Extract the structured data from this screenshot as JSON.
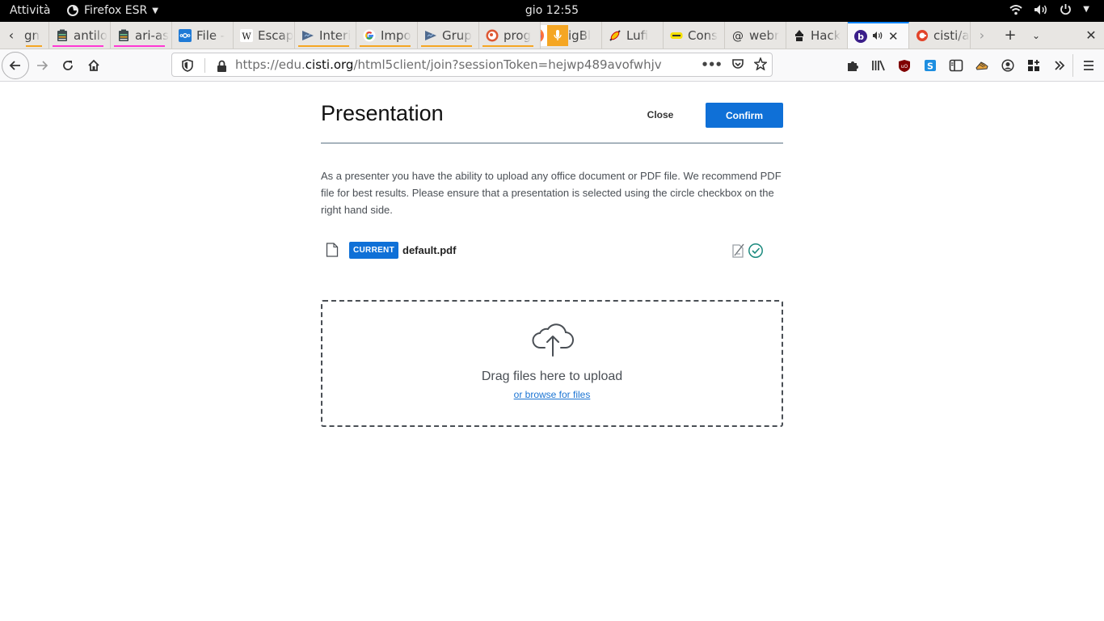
{
  "system_bar": {
    "activities": "Attività",
    "app_name": "Firefox ESR",
    "clock": "gio 12:55"
  },
  "tabs": [
    {
      "label": "gn",
      "underline": "#f5a623",
      "favicon": ""
    },
    {
      "label": "antilo",
      "underline": "#ff39d4",
      "favicon": "notes"
    },
    {
      "label": "ari-as",
      "underline": "#ff39d4",
      "favicon": "notes"
    },
    {
      "label": "File -",
      "underline": "",
      "favicon": "nextcloud"
    },
    {
      "label": "Escap",
      "underline": "",
      "favicon": "W"
    },
    {
      "label": "Interi",
      "underline": "#f5a623",
      "favicon": "jitsi"
    },
    {
      "label": "Impo",
      "underline": "#f5a623",
      "favicon": "G"
    },
    {
      "label": "Grup",
      "underline": "#f5a623",
      "favicon": "jitsi"
    },
    {
      "label": "prog",
      "underline": "#f5a623",
      "favicon": "duckduckgo"
    },
    {
      "label": "igBl",
      "underline": "",
      "favicon": "mic"
    },
    {
      "label": "Lufi",
      "underline": "",
      "favicon": "lufi"
    },
    {
      "label": "Cons",
      "underline": "",
      "favicon": "cons"
    },
    {
      "label": "webr",
      "underline": "",
      "favicon": "@"
    },
    {
      "label": "Hack",
      "underline": "",
      "favicon": "hack"
    },
    {
      "label": "",
      "underline": "",
      "favicon": "bbb",
      "active": true
    },
    {
      "label": "cisti/a",
      "underline": "",
      "favicon": "gitlab"
    }
  ],
  "navbar": {
    "url_prefix": "https://edu.",
    "url_domain": "cisti.org",
    "url_path": "/html5client/join?sessionToken=hejwp489avofwhjv"
  },
  "dialog": {
    "title": "Presentation",
    "close_label": "Close",
    "confirm_label": "Confirm",
    "description": "As a presenter you have the ability to upload any office document or PDF file. We recommend PDF file for best results. Please ensure that a presentation is selected using the circle checkbox on the right hand side.",
    "file": {
      "badge": "CURRENT",
      "name": "default.pdf"
    },
    "dropzone": {
      "title": "Drag files here to upload",
      "browse": "or browse for files"
    }
  },
  "colors": {
    "accent": "#0f70d7",
    "check": "#1b8a7e",
    "text": "#4a4f55"
  }
}
